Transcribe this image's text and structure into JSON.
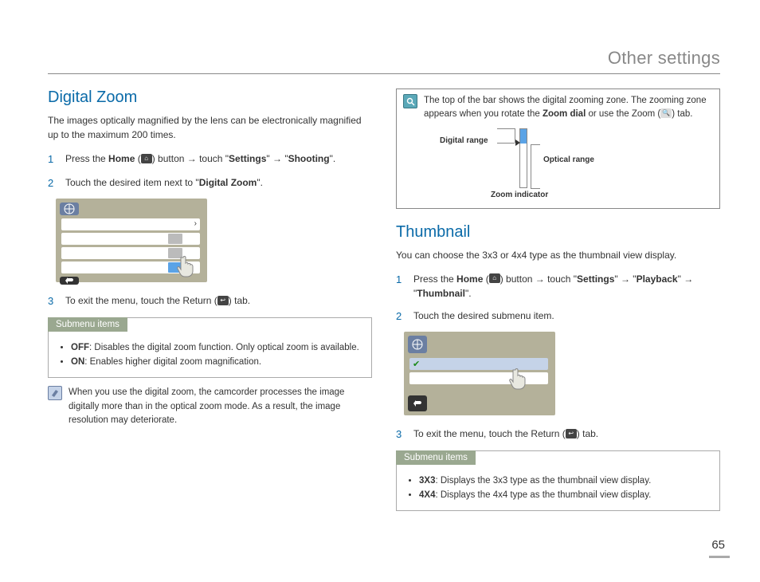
{
  "header": {
    "title": "Other settings"
  },
  "page_number": "65",
  "left": {
    "title": "Digital Zoom",
    "intro": "The images optically magnified by the lens can be electronically magnified up to the maximum 200 times.",
    "step1_a": "Press the ",
    "step1_home": "Home",
    "step1_b": " (",
    "step1_c": ") button → ",
    "step1_touch": "touch \"",
    "step1_settings": "Settings",
    "step1_d": "\" → \"",
    "step1_shooting": "Shooting",
    "step1_e": "\".",
    "step2_a": "Touch the desired item next to \"",
    "step2_b": "Digital Zoom",
    "step2_c": "\".",
    "step3_a": "To exit the menu, touch the Return (",
    "step3_b": ") tab.",
    "submenu_label": "Submenu items",
    "sub_off_bold": "OFF",
    "sub_off": ": Disables the digital zoom function. Only optical zoom is available.",
    "sub_on_bold": "ON",
    "sub_on": ": Enables higher digital zoom magnification.",
    "note": "When you use the digital zoom, the camcorder processes the image digitally more than in the optical zoom mode. As a result, the image resolution may deteriorate."
  },
  "right": {
    "info_a": "The top of the bar shows the digital zooming zone. The zooming zone appears when you rotate the ",
    "info_b": "Zoom dial",
    "info_c": " or use the Zoom (",
    "info_d": ") tab.",
    "zl_digital": "Digital range",
    "zl_optical": "Optical range",
    "zl_indicator": "Zoom indicator",
    "title": "Thumbnail",
    "intro": "You can choose the 3x3 or 4x4 type as the thumbnail view display.",
    "step1_a": "Press the ",
    "step1_home": "Home",
    "step1_b": " (",
    "step1_c": ") button → touch \"",
    "step1_settings": "Settings",
    "step1_d": "\" → \"",
    "step1_playback": "Playback",
    "step1_e": "\" → \"",
    "step1_thumbnail": "Thumbnail",
    "step1_f": "\".",
    "step2": "Touch the desired submenu item.",
    "step3_a": "To exit the menu, touch the Return (",
    "step3_b": ") tab.",
    "submenu_label": "Submenu items",
    "sub_3x3_bold": "3X3",
    "sub_3x3": ": Displays the 3x3 type as the thumbnail view display.",
    "sub_4x4_bold": "4X4",
    "sub_4x4": ": Displays the 4x4 type as the thumbnail view display."
  }
}
